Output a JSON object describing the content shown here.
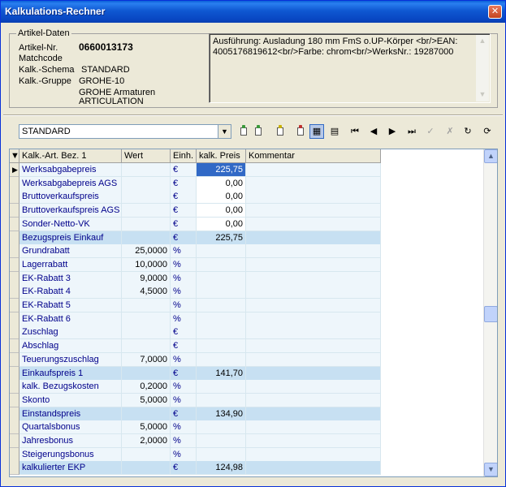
{
  "window": {
    "title": "Kalkulations-Rechner",
    "close": "✕"
  },
  "article": {
    "legend": "Artikel-Daten",
    "nr_label": "Artikel-Nr.",
    "nr_value": "0660013173",
    "matchcode_label": "Matchcode",
    "schema_label": "Kalk.-Schema",
    "schema_value": "STANDARD",
    "gruppe_label": "Kalk.-Gruppe",
    "gruppe_value": "GROHE-10",
    "gruppe_line2": "GROHE Armaturen",
    "gruppe_line3": "ARTICULATION",
    "description_line1": "Ausführung: Ausladung 180 mm FmS o.UP-Körper <br/>EAN:",
    "description_line2": "4005176819612<br/>Farbe: chrom<br/>WerksNr.: 19287000"
  },
  "toolbar": {
    "combo_value": "STANDARD",
    "buttons": [
      {
        "name": "new-record-icon",
        "glyph": "",
        "color": "#3a9a3a"
      },
      {
        "name": "copy-record-icon",
        "glyph": "",
        "color": "#3a9a3a"
      },
      {
        "name": "edit-record-icon",
        "glyph": "",
        "color": "#c9b000"
      },
      {
        "name": "delete-record-icon",
        "glyph": "",
        "color": "#c03030"
      },
      {
        "name": "calc-table-icon",
        "glyph": "▦"
      },
      {
        "name": "grid-settings-icon",
        "glyph": "▤"
      },
      {
        "name": "first-record-icon",
        "glyph": "⏮"
      },
      {
        "name": "prev-record-icon",
        "glyph": "◀"
      },
      {
        "name": "next-record-icon",
        "glyph": "▶"
      },
      {
        "name": "last-record-icon",
        "glyph": "⏭"
      },
      {
        "name": "confirm-icon",
        "glyph": "✓"
      },
      {
        "name": "cancel-icon",
        "glyph": "✗"
      },
      {
        "name": "refresh-icon",
        "glyph": "↻"
      },
      {
        "name": "recalculate-icon",
        "glyph": "⟳"
      }
    ]
  },
  "grid": {
    "columns": [
      "Kalk.-Art. Bez. 1",
      "Wert",
      "Einh.",
      "kalk. Preis",
      "Kommentar"
    ],
    "rows": [
      {
        "name": "Werksabgabepreis",
        "wert": "",
        "einh": "€",
        "preis": "225,75",
        "style": "light",
        "selected": true
      },
      {
        "name": "Werksabgabepreis AGS",
        "wert": "",
        "einh": "€",
        "preis": "0,00",
        "style": "light",
        "edit": true
      },
      {
        "name": "Bruttoverkaufspreis",
        "wert": "",
        "einh": "€",
        "preis": "0,00",
        "style": "light",
        "edit": true
      },
      {
        "name": "Bruttoverkaufspreis AGS",
        "wert": "",
        "einh": "€",
        "preis": "0,00",
        "style": "light",
        "edit": true
      },
      {
        "name": "Sonder-Netto-VK",
        "wert": "",
        "einh": "€",
        "preis": "0,00",
        "style": "light",
        "edit": true
      },
      {
        "name": "Bezugspreis Einkauf",
        "wert": "",
        "einh": "€",
        "preis": "225,75",
        "style": "highlight"
      },
      {
        "name": "Grundrabatt",
        "wert": "25,0000",
        "einh": "%",
        "preis": "",
        "style": "light"
      },
      {
        "name": "Lagerrabatt",
        "wert": "10,0000",
        "einh": "%",
        "preis": "",
        "style": "light"
      },
      {
        "name": "EK-Rabatt 3",
        "wert": "9,0000",
        "einh": "%",
        "preis": "",
        "style": "light"
      },
      {
        "name": "EK-Rabatt 4",
        "wert": "4,5000",
        "einh": "%",
        "preis": "",
        "style": "light"
      },
      {
        "name": "EK-Rabatt 5",
        "wert": "",
        "einh": "%",
        "preis": "",
        "style": "light"
      },
      {
        "name": "EK-Rabatt 6",
        "wert": "",
        "einh": "%",
        "preis": "",
        "style": "light"
      },
      {
        "name": "Zuschlag",
        "wert": "",
        "einh": "€",
        "preis": "",
        "style": "light"
      },
      {
        "name": "Abschlag",
        "wert": "",
        "einh": "€",
        "preis": "",
        "style": "light"
      },
      {
        "name": "Teuerungszuschlag",
        "wert": "7,0000",
        "einh": "%",
        "preis": "",
        "style": "light"
      },
      {
        "name": "Einkaufspreis 1",
        "wert": "",
        "einh": "€",
        "preis": "141,70",
        "style": "highlight"
      },
      {
        "name": "kalk. Bezugskosten",
        "wert": "0,2000",
        "einh": "%",
        "preis": "",
        "style": "light"
      },
      {
        "name": "Skonto",
        "wert": "5,0000",
        "einh": "%",
        "preis": "",
        "style": "light"
      },
      {
        "name": "Einstandspreis",
        "wert": "",
        "einh": "€",
        "preis": "134,90",
        "style": "highlight"
      },
      {
        "name": "Quartalsbonus",
        "wert": "5,0000",
        "einh": "%",
        "preis": "",
        "style": "light"
      },
      {
        "name": "Jahresbonus",
        "wert": "2,0000",
        "einh": "%",
        "preis": "",
        "style": "light"
      },
      {
        "name": "Steigerungsbonus",
        "wert": "",
        "einh": "%",
        "preis": "",
        "style": "light"
      },
      {
        "name": "kalkulierter EKP",
        "wert": "",
        "einh": "€",
        "preis": "124,98",
        "style": "highlight"
      }
    ]
  }
}
